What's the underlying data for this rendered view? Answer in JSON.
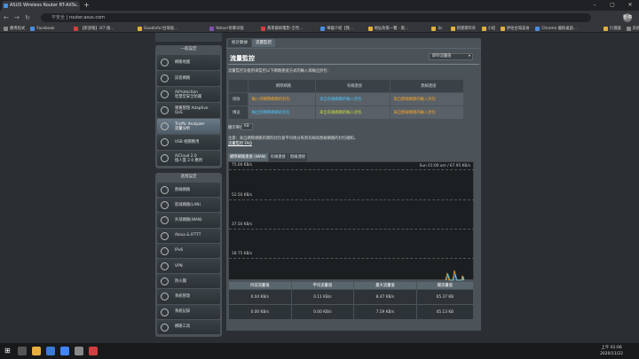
{
  "browser": {
    "tab_title": "ASUS Wireless Router RT-AX5...",
    "new_tab": "+",
    "url_warning": "不安全",
    "url": "router.asus.com",
    "avatar": "暫停",
    "bookmarks": [
      "應用程式",
      "Facebook",
      "【新週報】iX7 搜...",
      "Goodinfo!台灣股...",
      "Yahoo!奇摩早版",
      "黃景藝術電影-全然...",
      "華義介紹【我...",
      "地址政策一覽 - 奧...",
      "3c",
      "新建資料夾",
      "小程",
      "評估台灣美食",
      "Chrome 優換桌面...",
      "引選器",
      "其他書籤"
    ]
  },
  "sidebar": {
    "general_title": "一般設定",
    "general": [
      {
        "label": "網路地圖",
        "icon": "network-map-icon"
      },
      {
        "label": "訪客網路",
        "icon": "guest-network-icon"
      },
      {
        "label": "AiProtection",
        "sub": "智慧型安全防護",
        "icon": "shield-icon"
      },
      {
        "label": "頻寬管理 Adaptive",
        "sub": "QoS",
        "icon": "qos-icon"
      },
      {
        "label": "Traffic Analyzer",
        "sub": "流量分析",
        "icon": "traffic-icon",
        "active": true
      },
      {
        "label": "USB 相關應用",
        "icon": "usb-icon"
      },
      {
        "label": "AiCloud 2.0",
        "sub": "個人雲 2.0 應用",
        "icon": "cloud-icon"
      }
    ],
    "advanced_title": "進階設定",
    "advanced": [
      {
        "label": "無線網路",
        "icon": "wireless-icon"
      },
      {
        "label": "區域網路(LAN)",
        "icon": "lan-icon"
      },
      {
        "label": "外部網路(WAN)",
        "icon": "wan-icon"
      },
      {
        "label": "Alexa & IFTTT",
        "icon": "alexa-icon"
      },
      {
        "label": "IPv6",
        "icon": "ipv6-icon"
      },
      {
        "label": "VPN",
        "icon": "vpn-icon"
      },
      {
        "label": "防火牆",
        "icon": "firewall-icon"
      },
      {
        "label": "系統管理",
        "icon": "admin-icon"
      },
      {
        "label": "系統記錄",
        "icon": "log-icon"
      },
      {
        "label": "網路工具",
        "icon": "tools-icon"
      }
    ]
  },
  "content": {
    "tabs": [
      "統計數據",
      "流量監控"
    ],
    "title": "流量監控",
    "mode_select": "即時流量值",
    "desc": "流量監控功能用來監控以下網路連接方式的輸入與輸出封包：",
    "table": {
      "headers": [
        "",
        "網際網路",
        "有線連接",
        "無線連接"
      ],
      "rows": [
        {
          "label": "接收",
          "cells": [
            "輸入到網際網路的封包",
            "來自有線網路的輸入封包",
            "來自無線網路的輸入封包"
          ]
        },
        {
          "label": "傳送",
          "cells": [
            "輸出到網際網路的封包",
            "來自有線網路的輸入封包",
            "來自無線網路的輸入封包"
          ]
        }
      ]
    },
    "unit_label": "顯示單位",
    "unit_value": "KB",
    "note": "注意：來自網際網路的資料封包會平均地分佈到有線與無線網路的封包總和。",
    "faq": "流量監控 FAQ",
    "graph_tabs": [
      "網際網路連接 (WAN)",
      "有線連接",
      "無線連接"
    ],
    "graph": {
      "time_label": "Sun 01:00 am / 67.95 KB/s",
      "y_labels": [
        "75.00 KB/s",
        "52.50 KB/s",
        "37.50 KB/s",
        "18.75 KB/s"
      ]
    },
    "stats": {
      "headers": [
        "目前流量值",
        "平均流量值",
        "最大流量值",
        "總流量值"
      ],
      "rows": [
        [
          "0.04 KB/s",
          "0.11 KB/s",
          "8.47 KB/s",
          "65.37 KB"
        ],
        [
          "0.00 KB/s",
          "0.00 KB/s",
          "7.59 KB/s",
          "45.13 KB"
        ]
      ]
    }
  },
  "taskbar": {
    "time": "上午 01:06",
    "date": "2020/11/22"
  }
}
